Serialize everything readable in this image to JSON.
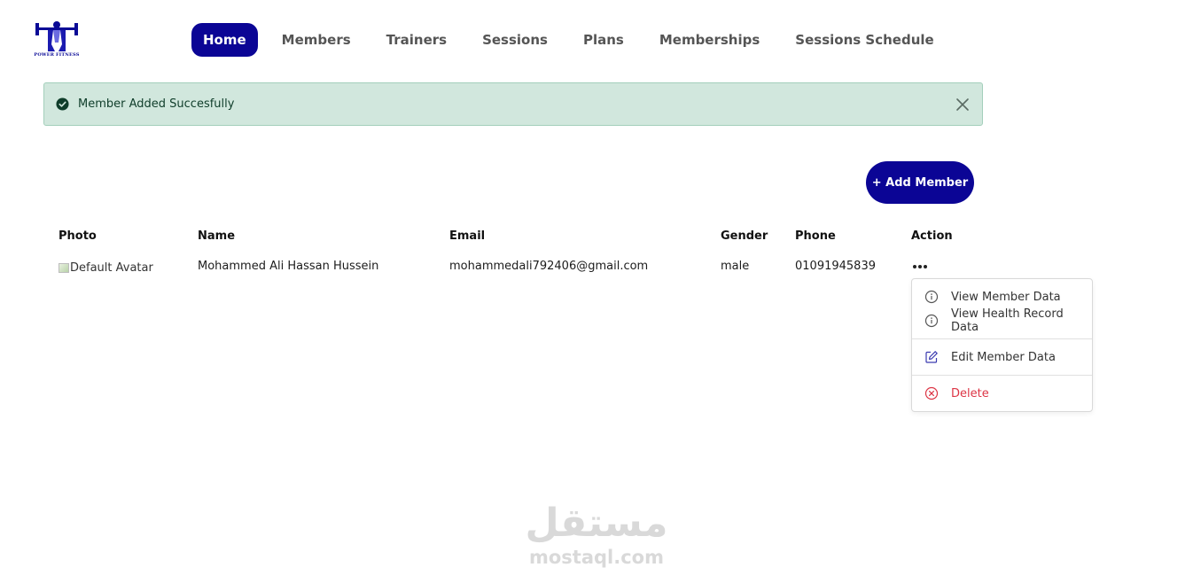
{
  "logo": {
    "text": "POWER FITNESS",
    "color": "#0a0a96"
  },
  "nav": {
    "items": [
      {
        "label": "Home",
        "active": true
      },
      {
        "label": "Members",
        "active": false
      },
      {
        "label": "Trainers",
        "active": false
      },
      {
        "label": "Sessions",
        "active": false
      },
      {
        "label": "Plans",
        "active": false
      },
      {
        "label": "Memberships",
        "active": false
      },
      {
        "label": "Sessions Schedule",
        "active": false
      }
    ]
  },
  "alert": {
    "message": "Member Added Succesfully",
    "icon": "check-circle-icon",
    "close_icon": "close-icon"
  },
  "add_member_button": {
    "label": "+ Add Member"
  },
  "table": {
    "headers": {
      "photo": "Photo",
      "name": "Name",
      "email": "Email",
      "gender": "Gender",
      "phone": "Phone",
      "action": "Action"
    },
    "rows": [
      {
        "photo_alt": "Default Avatar",
        "name": "Mohammed Ali Hassan Hussein",
        "email": "mohammedali792406@gmail.com",
        "gender": "male",
        "phone": "01091945839",
        "action_icon": "more-horizontal-icon"
      }
    ]
  },
  "action_menu": {
    "view_member": {
      "label": "View Member Data",
      "icon": "info-icon"
    },
    "view_health": {
      "label": "View Health Record Data",
      "icon": "info-icon"
    },
    "edit": {
      "label": "Edit Member Data",
      "icon": "edit-icon"
    },
    "delete": {
      "label": "Delete",
      "icon": "x-circle-icon"
    }
  },
  "watermark": {
    "arabic": "مستقل",
    "latin": "mostaql.com"
  },
  "colors": {
    "primary": "#0b0595",
    "success_bg": "#d1e7dd",
    "danger": "#dc3545"
  }
}
